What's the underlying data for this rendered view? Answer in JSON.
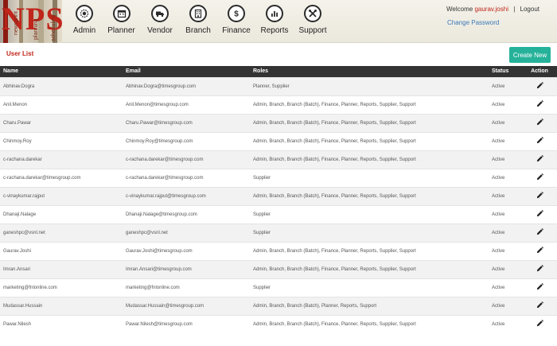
{
  "header": {
    "logo": {
      "letters": "NPS",
      "tagline_1": "newsprint",
      "tagline_2": "planning",
      "tagline_3": "scheduling"
    },
    "nav": [
      {
        "label": "Admin",
        "icon": "admin-icon"
      },
      {
        "label": "Planner",
        "icon": "calendar-icon"
      },
      {
        "label": "Vendor",
        "icon": "truck-icon"
      },
      {
        "label": "Branch",
        "icon": "building-icon"
      },
      {
        "label": "Finance",
        "icon": "dollar-icon"
      },
      {
        "label": "Reports",
        "icon": "chart-icon"
      },
      {
        "label": "Support",
        "icon": "tools-icon"
      }
    ],
    "user": {
      "welcome": "Welcome",
      "username": "gaurav.joshi",
      "separator": "|",
      "logout": "Logout",
      "change_password": "Change Password"
    }
  },
  "page": {
    "title": "User List",
    "create_button": "Create New"
  },
  "table": {
    "columns": [
      "Name",
      "Email",
      "Roles",
      "Status",
      "Action"
    ],
    "rows": [
      {
        "name": "Abhinav.Dogra",
        "email": "Abhinav.Dogra@timesgroup.com",
        "roles": "Planner, Supplier",
        "status": "Active"
      },
      {
        "name": "Anil.Menon",
        "email": "Anil.Menon@timesgroup.com",
        "roles": "Admin, Branch, Branch (Batch), Finance, Planner, Reports, Supplier, Support",
        "status": "Active"
      },
      {
        "name": "Charu.Pawar",
        "email": "Charu.Pawar@timesgroup.com",
        "roles": "Admin, Branch, Branch (Batch), Finance, Planner, Reports, Supplier, Support",
        "status": "Active"
      },
      {
        "name": "Chinmoy.Roy",
        "email": "Chinmoy.Roy@timesgroup.com",
        "roles": "Admin, Branch, Branch (Batch), Finance, Planner, Reports, Supplier, Support",
        "status": "Active"
      },
      {
        "name": "c-rachana.darekar",
        "email": "c-rachana.darekar@timesgroup.com",
        "roles": "Admin, Branch, Branch (Batch), Finance, Planner, Reports, Supplier, Support",
        "status": "Active"
      },
      {
        "name": "c-rachana.darekar@timesgroup.com",
        "email": "c-rachana.darekar@timesgroup.com",
        "roles": "Supplier",
        "status": "Active"
      },
      {
        "name": "c-vinaykumar.rajput",
        "email": "c-vinaykumar.rajput@timesgroup.com",
        "roles": "Admin, Branch, Branch (Batch), Finance, Planner, Reports, Supplier, Support",
        "status": "Active"
      },
      {
        "name": "Dhanaji.Nalage",
        "email": "Dhanaji.Nalage@timesgroup.com",
        "roles": "Supplier",
        "status": "Active"
      },
      {
        "name": "ganeshpc@vsnl.net",
        "email": "ganeshpc@vsnl.net",
        "roles": "Supplier",
        "status": "Active"
      },
      {
        "name": "Gaurav.Joshi",
        "email": "Gaurav.Joshi@timesgroup.com",
        "roles": "Admin, Branch, Branch (Batch), Finance, Planner, Reports, Supplier, Support",
        "status": "Active"
      },
      {
        "name": "Imran.Ansari",
        "email": "Imran.Ansari@timesgroup.com",
        "roles": "Admin, Branch, Branch (Batch), Finance, Planner, Reports, Supplier, Support",
        "status": "Active"
      },
      {
        "name": "marketing@fnlonline.com",
        "email": "marketing@fnlonline.com",
        "roles": "Supplier",
        "status": "Active"
      },
      {
        "name": "Mudassar.Hussain",
        "email": "Mudassar.Hussain@timesgroup.com",
        "roles": "Admin, Branch, Branch (Batch), Planner, Reports, Support",
        "status": "Active"
      },
      {
        "name": "Pawar.Nilesh",
        "email": "Pawar.Nilesh@timesgroup.com",
        "roles": "Admin, Branch, Branch (Batch), Finance, Planner, Reports, Supplier, Support",
        "status": "Active"
      }
    ]
  },
  "colors": {
    "brand_red": "#c0261b",
    "accent_teal": "#26b29a",
    "header_dark": "#333333",
    "link_blue": "#3a78b8"
  }
}
